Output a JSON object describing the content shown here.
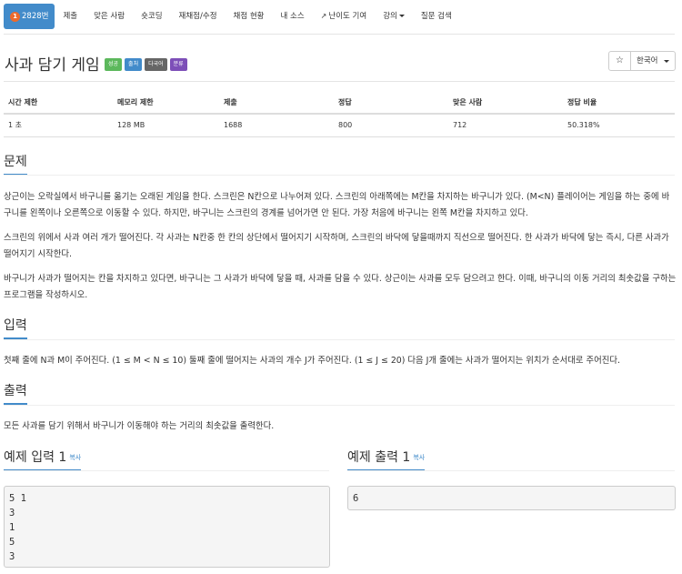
{
  "nav": {
    "problem_number": "2828번",
    "items": [
      "제출",
      "맞은 사람",
      "숏코딩",
      "재채점/수정",
      "채점 현황",
      "내 소스",
      "난이도 기여",
      "강의",
      "질문 검색"
    ]
  },
  "title": "사과 담기 게임",
  "labels": [
    "성공",
    "출처",
    "다국어",
    "분류"
  ],
  "language": "한국어",
  "star": "☆",
  "info": {
    "headers": [
      "시간 제한",
      "메모리 제한",
      "제출",
      "정답",
      "맞은 사람",
      "정답 비율"
    ],
    "values": [
      "1 초",
      "128 MB",
      "1688",
      "800",
      "712",
      "50.318%"
    ]
  },
  "sections": {
    "problem": {
      "heading": "문제",
      "paragraphs": [
        "상근이는 오락실에서 바구니를 옮기는 오래된 게임을 한다. 스크린은 N칸으로 나누어져 있다. 스크린의 아래쪽에는 M칸을 차지하는 바구니가 있다. (M<N) 플레이어는 게임을 하는 중에 바구니를 왼쪽이나 오른쪽으로 이동할 수 있다. 하지만, 바구니는 스크린의 경계를 넘어가면 안 된다. 가장 처음에 바구니는 왼쪽 M칸을 차지하고 있다.",
        "스크린의 위에서 사과 여러 개가 떨어진다. 각 사과는 N칸중 한 칸의 상단에서 떨어지기 시작하며, 스크린의 바닥에 닿을때까지 직선으로 떨어진다. 한 사과가 바닥에 닿는 즉시, 다른 사과가 떨어지기 시작한다.",
        "바구니가 사과가 떨어지는 칸을 차지하고 있다면, 바구니는 그 사과가 바닥에 닿을 때, 사과를 담을 수 있다. 상근이는 사과를 모두 담으려고 한다. 이때, 바구니의 이동 거리의 최솟값을 구하는 프로그램을 작성하시오."
      ]
    },
    "input": {
      "heading": "입력",
      "text": "첫째 줄에 N과 M이 주어진다. (1 ≤ M < N ≤ 10) 둘째 줄에 떨어지는 사과의 개수 J가 주어진다. (1 ≤ J ≤ 20) 다음 J개 줄에는 사과가 떨어지는 위치가 순서대로 주어진다."
    },
    "output": {
      "heading": "출력",
      "text": "모든 사과를 담기 위해서 바구니가 이동해야 하는 거리의 최솟값을 출력한다."
    },
    "sample_input": {
      "heading": "예제 입력 1",
      "copy": "복사",
      "lines": [
        "5 1",
        "3",
        "1",
        "5",
        "3"
      ]
    },
    "sample_output": {
      "heading": "예제 출력 1",
      "copy": "복사",
      "lines": [
        "6"
      ]
    }
  }
}
